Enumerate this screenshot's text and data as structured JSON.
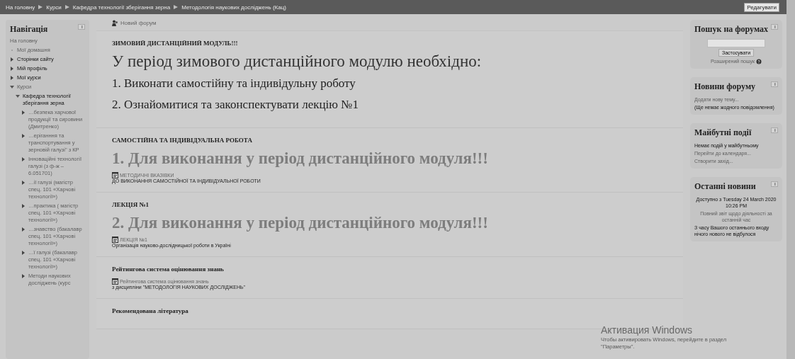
{
  "breadcrumbs": [
    "На головну",
    "Курси",
    "Кафедра технології зберігання зерна",
    "Методологія наукових досліджень (Кац)"
  ],
  "edit_button": "Редагувати",
  "navigation": {
    "title": "Навігація",
    "items": [
      {
        "kind": "home",
        "label": "На головну",
        "dimmed": true
      },
      {
        "kind": "bullet",
        "label": "Мої домашня",
        "dimmed": true
      },
      {
        "kind": "branch",
        "label": "Сторінки сайту",
        "dimmed": false,
        "expanded": false
      },
      {
        "kind": "branch",
        "label": "Мій профіль",
        "dimmed": false,
        "expanded": false
      },
      {
        "kind": "branch",
        "label": "Мої курси",
        "dimmed": false,
        "expanded": false
      },
      {
        "kind": "branch",
        "label": "Курси",
        "dimmed": true,
        "expanded": true,
        "children": [
          {
            "kind": "branch",
            "label": "Кафедра технології зберігання зерна",
            "dimmed": false,
            "expanded": true,
            "children": [
              {
                "kind": "branch",
                "label": "…безпека харчової продукції та сировини (Дмитренко)",
                "dimmed": true,
                "expanded": false
              },
              {
                "kind": "branch",
                "label": "…еріганння та транспортування у зерновій галузі\" з КР",
                "dimmed": true,
                "expanded": false
              },
              {
                "kind": "branch",
                "label": "Інноваційні технології галузі (з ф-ж – 6.051701)",
                "dimmed": true,
                "expanded": false
              },
              {
                "kind": "branch",
                "label": "…ії галузі (магістр спец. 101 «Харчові технології»)",
                "dimmed": true,
                "expanded": false
              },
              {
                "kind": "branch",
                "label": "…практика ( магістр спец. 101 «Харчові технології»)",
                "dimmed": true,
                "expanded": false
              },
              {
                "kind": "branch",
                "label": "…знавство (бакалавр спец. 101 «Харчові технології»)",
                "dimmed": true,
                "expanded": false
              },
              {
                "kind": "branch",
                "label": "…ї галузі (бакалавр спец. 101 «Харчові технології»)",
                "dimmed": true,
                "expanded": false
              },
              {
                "kind": "branch",
                "label": "Методи наукових досліджень (курс",
                "dimmed": true,
                "expanded": false
              }
            ]
          }
        ]
      }
    ]
  },
  "new_forum": "Новий форум",
  "sections": [
    {
      "heading": "ЗИМОВИЙ ДИСТАНЦІЙНИЙ МОДУЛЬ!!!",
      "blocks": [
        {
          "kind": "title",
          "text": "У період зимового дистанційного модулю необхідно:"
        },
        {
          "kind": "item",
          "text": "1. Виконати самостійну та індивідульну роботу"
        },
        {
          "kind": "item",
          "text": "2. Ознайомитися та законспектувати лекцію №1"
        }
      ]
    },
    {
      "heading": "САМОСТІЙНА ТА ІНДИВІДУАЛЬНА РОБОТА",
      "blocks": [
        {
          "kind": "banner",
          "text": "1. Для виконання у період дистанційного модуля!!!"
        },
        {
          "kind": "resource",
          "link": "МЕТОДИЧНІ ВКАЗІВКИ",
          "text": "ДО ВИКОНАННЯ САМОСТІЙНОЇ ТА ІНДИВІДУАЛЬНОЇ РОБОТИ"
        }
      ]
    },
    {
      "heading": "ЛЕКЦІЯ №1",
      "blocks": [
        {
          "kind": "banner",
          "text": "2. Для виконання у період дистанційного модуля!!!"
        },
        {
          "kind": "resource",
          "link": "ЛЕКЦІЯ №1",
          "text": "Організація науково-дослідницької роботи в Україні"
        }
      ]
    },
    {
      "heading": "Рейтингова система оцінювання знань",
      "blocks": [
        {
          "kind": "resource",
          "link": "Рейтингова система оцінювання знань",
          "text": "з дисципліни \"МЕТОДОЛОГІЯ НАУКОВИХ ДОСЛІДЖЕНЬ\""
        }
      ]
    },
    {
      "heading": "Рекомендована література"
    }
  ],
  "blocks": [
    {
      "title": "Пошук на форумах",
      "lines": [
        {
          "kind": "search",
          "button": "Застосувати"
        },
        {
          "kind": "help-link",
          "text": "Розширений пошук"
        }
      ]
    },
    {
      "title": "Новини форуму",
      "lines": [
        {
          "kind": "link",
          "text": "Додати нову тему..."
        },
        {
          "kind": "text",
          "text": "(Ще немає жодного повідомлення)"
        }
      ]
    },
    {
      "title": "Майбутні події",
      "lines": [
        {
          "kind": "text",
          "text": "Немає подій у майбутньому"
        },
        {
          "kind": "link",
          "text": "Перейти до календаря..."
        },
        {
          "kind": "link",
          "text": "Створити захід..."
        }
      ]
    },
    {
      "title": "Останні новини",
      "lines": [
        {
          "kind": "center-text",
          "text": "Доступно з Tuesday 24 March 2020 10:26 PM"
        },
        {
          "kind": "center-link",
          "text": "Повний звіт щодо діяльності за останній час"
        },
        {
          "kind": "text",
          "text": "З часу Вашого останнього входу нічого нового не відбулося"
        }
      ]
    }
  ],
  "activation_notice": {
    "title": "Активация Windows",
    "lines": [
      "Чтобы активировать Windows, перейдите в раздел",
      "\"Параметры\"."
    ]
  }
}
